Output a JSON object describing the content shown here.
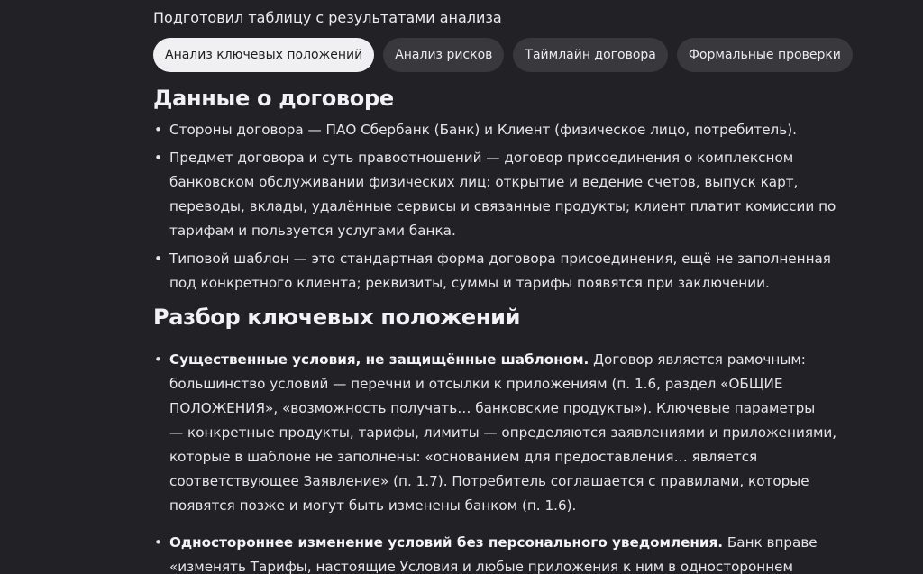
{
  "intro": "Подготовил таблицу с результатами анализа",
  "tabs": [
    {
      "label": "Анализ ключевых положений",
      "active": true
    },
    {
      "label": "Анализ рисков",
      "active": false
    },
    {
      "label": "Таймлайн договора",
      "active": false
    },
    {
      "label": "Формальные проверки",
      "active": false
    }
  ],
  "sections": {
    "contract": {
      "heading": "Данные о договоре",
      "items": [
        {
          "lines": [
            "Стороны договора — ПАО Сбербанк (Банк) и Клиент (физическое лицо, потребитель)."
          ]
        },
        {
          "lines": [
            "Предмет договора и суть правоотношений — договор присоединения о комплексном",
            "банковском обслуживании физических лиц: открытие и ведение счетов, выпуск карт,",
            "переводы, вклады, удалённые сервисы и связанные продукты; клиент платит комиссии по",
            "тарифам и пользуется услугами банка."
          ]
        },
        {
          "lines": [
            "Типовой шаблон — это стандартная форма договора присоединения, ещё не заполненная",
            "под конкретного клиента; реквизиты, суммы и тарифы появятся при заключении."
          ]
        }
      ]
    },
    "analysis": {
      "heading": "Разбор ключевых положений",
      "items": [
        {
          "title": "Существенные условия, не защищённые шаблоном.",
          "first": " Договор является рамочным:",
          "lines": [
            "большинство условий — перечни и отсылки к приложениям (п. 1.6, раздел «ОБЩИЕ",
            "ПОЛОЖЕНИЯ», «возможность получать… банковские продукты»). Ключевые параметры",
            "— конкретные продукты, тарифы, лимиты — определяются заявлениями и приложениями,",
            "которые в шаблоне не заполнены: «основанием для предоставления… является",
            "соответствующее Заявление» (п. 1.7). Потребитель соглашается с правилами, которые",
            "появятся позже и могут быть изменены банком (п. 1.6)."
          ]
        },
        {
          "title": "Одностороннее изменение условий без персонального уведомления.",
          "first": " Банк вправе",
          "lines": [
            "«изменять Тарифы, настоящие Условия и любые приложения к ним в одностороннем"
          ]
        }
      ]
    }
  }
}
